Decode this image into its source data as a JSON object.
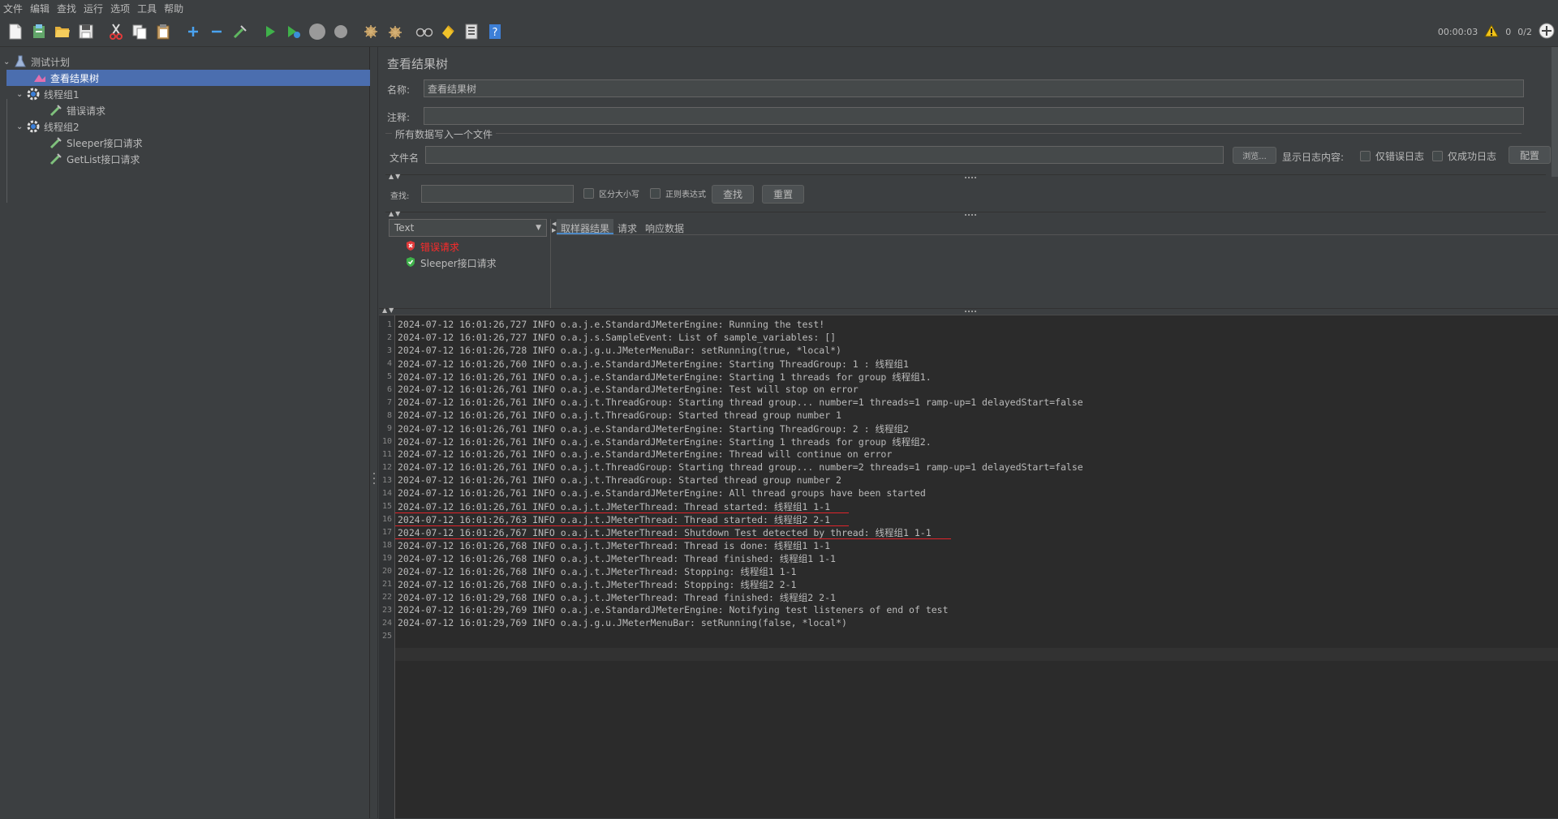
{
  "menu": [
    "文件",
    "编辑",
    "查找",
    "运行",
    "选项",
    "工具",
    "帮助"
  ],
  "toolbar": {
    "icons": [
      "new-icon",
      "templates-icon",
      "open-icon",
      "save-icon",
      "cut-icon",
      "copy-icon",
      "paste-icon",
      "expand-icon",
      "collapse-icon",
      "toggle-icon",
      "start-icon",
      "start-no-pause-icon",
      "stop-icon",
      "shutdown-icon",
      "clear-icon",
      "clear-all-icon",
      "search-icon",
      "reset-search-icon",
      "function-helper-icon",
      "help-icon"
    ],
    "elapsed": "00:00:03",
    "warnings": "0",
    "threads": "0/2"
  },
  "tree": {
    "root": "测试计划",
    "listener": "查看结果树",
    "group1": "线程组1",
    "group1_req": "错误请求",
    "group2": "线程组2",
    "group2_req1": "Sleeper接口请求",
    "group2_req2": "GetList接口请求"
  },
  "panel": {
    "title": "查看结果树",
    "name_label": "名称:",
    "name_value": "查看结果树",
    "comment_label": "注释:",
    "comment_value": "",
    "file_section": "所有数据写入一个文件",
    "filename_label": "文件名",
    "filename_value": "",
    "browse": "浏览...",
    "log_content_label": "显示日志内容:",
    "errors_only": "仅错误日志",
    "success_only": "仅成功日志",
    "configure": "配置",
    "search_label": "查找:",
    "search_value": "",
    "case_sensitive": "区分大小写",
    "regex": "正则表达式",
    "find_button": "查找",
    "reset_button": "重置",
    "renderer": "Text",
    "results": [
      {
        "label": "错误请求",
        "status": "error",
        "color": "#ff2a2a"
      },
      {
        "label": "Sleeper接口请求",
        "status": "success",
        "color": "#bbbbbb"
      }
    ],
    "tabs": [
      "取样器结果",
      "请求",
      "响应数据"
    ]
  },
  "log": {
    "lines": [
      "2024-07-12 16:01:26,727 INFO o.a.j.e.StandardJMeterEngine: Running the test!",
      "2024-07-12 16:01:26,727 INFO o.a.j.s.SampleEvent: List of sample_variables: []",
      "2024-07-12 16:01:26,728 INFO o.a.j.g.u.JMeterMenuBar: setRunning(true, *local*)",
      "2024-07-12 16:01:26,760 INFO o.a.j.e.StandardJMeterEngine: Starting ThreadGroup: 1 : 线程组1",
      "2024-07-12 16:01:26,761 INFO o.a.j.e.StandardJMeterEngine: Starting 1 threads for group 线程组1.",
      "2024-07-12 16:01:26,761 INFO o.a.j.e.StandardJMeterEngine: Test will stop on error",
      "2024-07-12 16:01:26,761 INFO o.a.j.t.ThreadGroup: Starting thread group... number=1 threads=1 ramp-up=1 delayedStart=false",
      "2024-07-12 16:01:26,761 INFO o.a.j.t.ThreadGroup: Started thread group number 1",
      "2024-07-12 16:01:26,761 INFO o.a.j.e.StandardJMeterEngine: Starting ThreadGroup: 2 : 线程组2",
      "2024-07-12 16:01:26,761 INFO o.a.j.e.StandardJMeterEngine: Starting 1 threads for group 线程组2.",
      "2024-07-12 16:01:26,761 INFO o.a.j.e.StandardJMeterEngine: Thread will continue on error",
      "2024-07-12 16:01:26,761 INFO o.a.j.t.ThreadGroup: Starting thread group... number=2 threads=1 ramp-up=1 delayedStart=false",
      "2024-07-12 16:01:26,761 INFO o.a.j.t.ThreadGroup: Started thread group number 2",
      "2024-07-12 16:01:26,761 INFO o.a.j.e.StandardJMeterEngine: All thread groups have been started",
      "2024-07-12 16:01:26,761 INFO o.a.j.t.JMeterThread: Thread started: 线程组1 1-1",
      "2024-07-12 16:01:26,763 INFO o.a.j.t.JMeterThread: Thread started: 线程组2 2-1",
      "2024-07-12 16:01:26,767 INFO o.a.j.t.JMeterThread: Shutdown Test detected by thread: 线程组1 1-1",
      "2024-07-12 16:01:26,768 INFO o.a.j.t.JMeterThread: Thread is done: 线程组1 1-1",
      "2024-07-12 16:01:26,768 INFO o.a.j.t.JMeterThread: Thread finished: 线程组1 1-1",
      "2024-07-12 16:01:26,768 INFO o.a.j.t.JMeterThread: Stopping: 线程组1 1-1",
      "2024-07-12 16:01:26,768 INFO o.a.j.t.JMeterThread: Stopping: 线程组2 2-1",
      "2024-07-12 16:01:29,768 INFO o.a.j.t.JMeterThread: Thread finished: 线程组2 2-1",
      "2024-07-12 16:01:29,769 INFO o.a.j.e.StandardJMeterEngine: Notifying test listeners of end of test",
      "2024-07-12 16:01:29,769 INFO o.a.j.g.u.JMeterMenuBar: setRunning(false, *local*)",
      ""
    ],
    "highlighted_lines": [
      15,
      16,
      17
    ],
    "highlight_color": "#e0242b"
  }
}
